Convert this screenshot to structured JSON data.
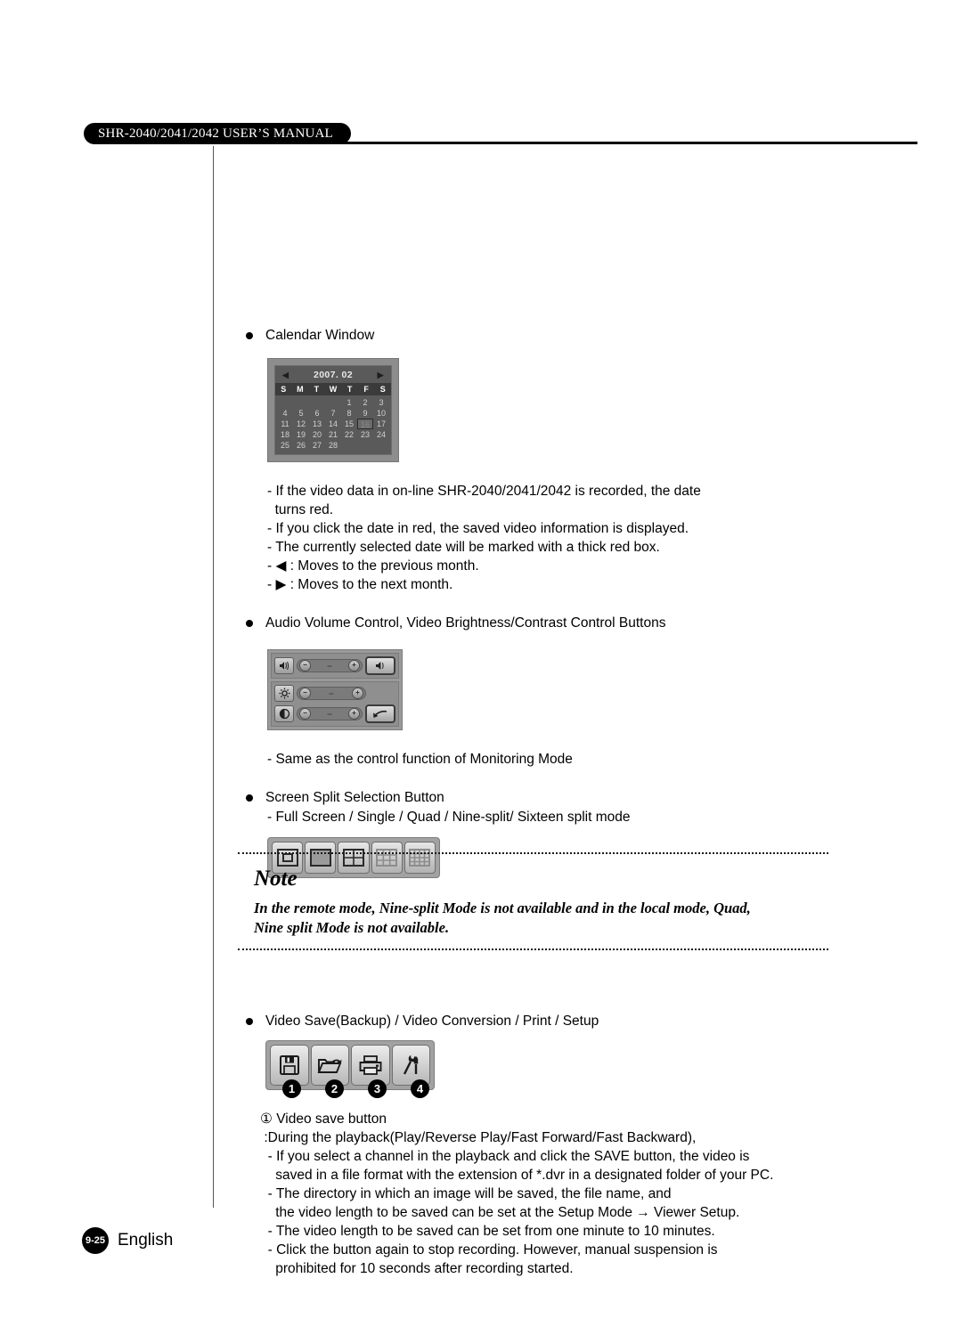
{
  "header": {
    "manual_title": "SHR-2040/2041/2042 USER’S MANUAL"
  },
  "sections": {
    "calendar": {
      "heading": "Calendar Window",
      "widget": {
        "prev_arrow": "◀",
        "next_arrow": "▶",
        "title": "2007. 02",
        "day_headers": [
          "S",
          "M",
          "T",
          "W",
          "T",
          "F",
          "S"
        ],
        "leading_blanks": 4,
        "days": [
          1,
          2,
          3,
          4,
          5,
          6,
          7,
          8,
          9,
          10,
          11,
          12,
          13,
          14,
          15,
          16,
          17,
          18,
          19,
          20,
          21,
          22,
          23,
          24,
          25,
          26,
          27,
          28
        ],
        "selected_day": 16
      },
      "notes": "- If the video data in on-line SHR-2040/2041/2042 is recorded, the date\n  turns red.\n- If you click the date in red, the saved video information is displayed.\n- The currently selected date will be marked with a thick red box.\n- ◀ : Moves to the previous month.\n- ▶ : Moves to the next month."
    },
    "av_control": {
      "heading": "Audio Volume Control, Video Brightness/Contrast Control Buttons",
      "rows": [
        {
          "icon": "speaker-icon",
          "minus": "−",
          "plus": "+",
          "action": "mute-speaker-icon"
        },
        {
          "icon": "brightness-sun-icon",
          "minus": "−",
          "plus": "+",
          "action": ""
        },
        {
          "icon": "contrast-half-circle-icon",
          "minus": "−",
          "plus": "+",
          "action": "reset-arrow-icon"
        }
      ],
      "note": "- Same as the control function of Monitoring Mode"
    },
    "screen_split": {
      "heading": "Screen Split Selection Button",
      "note": "- Full Screen / Single / Quad / Nine-split/ Sixteen split mode",
      "buttons": [
        {
          "name": "full-screen-split-icon",
          "grid": 0
        },
        {
          "name": "single-split-icon",
          "grid": 1
        },
        {
          "name": "quad-split-icon",
          "grid": 2
        },
        {
          "name": "nine-split-icon",
          "grid": 3
        },
        {
          "name": "sixteen-split-icon",
          "grid": 4
        }
      ]
    },
    "note_box": {
      "title": "Note",
      "text": "In the remote mode, Nine-split Mode is not available and in the local mode, Quad,\nNine split Mode is not available."
    },
    "video_save": {
      "heading": "Video Save(Backup) / Video Conversion / Print / Setup",
      "buttons": [
        {
          "icon": "floppy-disk-save-icon",
          "callout": "1"
        },
        {
          "icon": "folder-conversion-icon",
          "callout": "2"
        },
        {
          "icon": "printer-icon",
          "callout": "3"
        },
        {
          "icon": "wrench-screwdriver-setup-icon",
          "callout": "4"
        }
      ],
      "detail_title": "① Video save button",
      "detail_text": " :During the playback(Play/Reverse Play/Fast Forward/Fast Backward),\n  - If you select a channel in the playback and click the SAVE button, the video is\n    saved in a file format with the extension of *.dvr in a designated folder of your PC.\n  - The directory in which an image will be saved, the file name, and\n    the video length to be saved can be set at the Setup Mode → Viewer Setup.\n  - The video length to be saved can be set from one minute to 10 minutes.\n  - Click the button again to stop recording. However, manual suspension is\n    prohibited for 10 seconds after recording started."
    }
  },
  "footer": {
    "page_number": "9-25",
    "language": "English"
  }
}
